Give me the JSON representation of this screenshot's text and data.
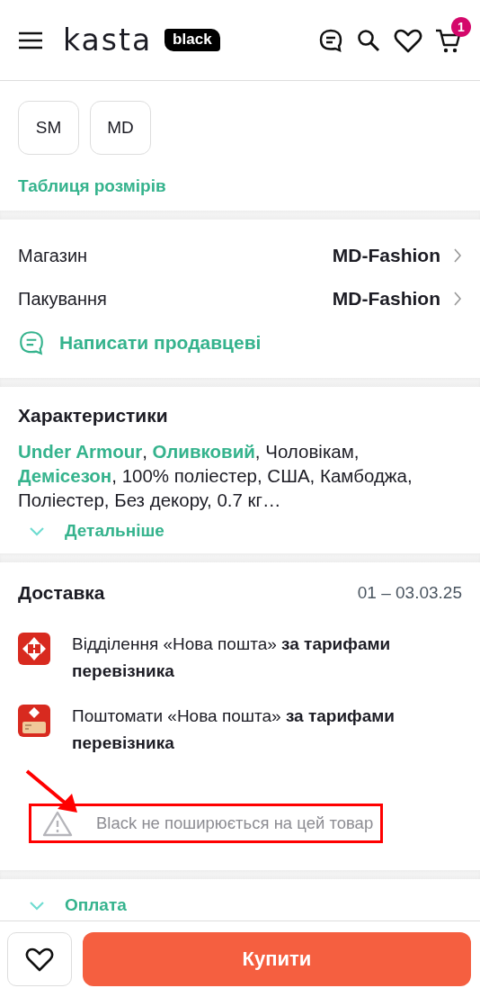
{
  "header": {
    "logo": "kasta",
    "badge": "black",
    "cart_count": "1"
  },
  "sizes": [
    {
      "label": "SM"
    },
    {
      "label": "MD"
    }
  ],
  "size_table_link": "Таблиця розмірів",
  "seller": {
    "rows": [
      {
        "label": "Магазин",
        "value": "MD-Fashion"
      },
      {
        "label": "Пакування",
        "value": "MD-Fashion"
      }
    ],
    "contact": "Написати продавцеві"
  },
  "characteristics": {
    "title": "Характеристики",
    "text": "**Under Armour**, **Оливковий**, Чоловікам, **Демісезон**, 100% поліестер, США, Камбоджа, Поліестер, Без декору, 0.7 кг…",
    "more": "Детальніше"
  },
  "delivery": {
    "title": "Доставка",
    "dates": "01 – 03.03.25",
    "options": [
      {
        "kind": "branch",
        "text": "Відділення «Нова пошта»  **за тарифами перевізника**"
      },
      {
        "kind": "locker",
        "text": "Поштомати «Нова пошта»  **за тарифами перевізника**"
      }
    ],
    "note": "Black не поширюється на цей товар"
  },
  "payment": {
    "label": "Оплата"
  },
  "buy_button": "Купити"
}
